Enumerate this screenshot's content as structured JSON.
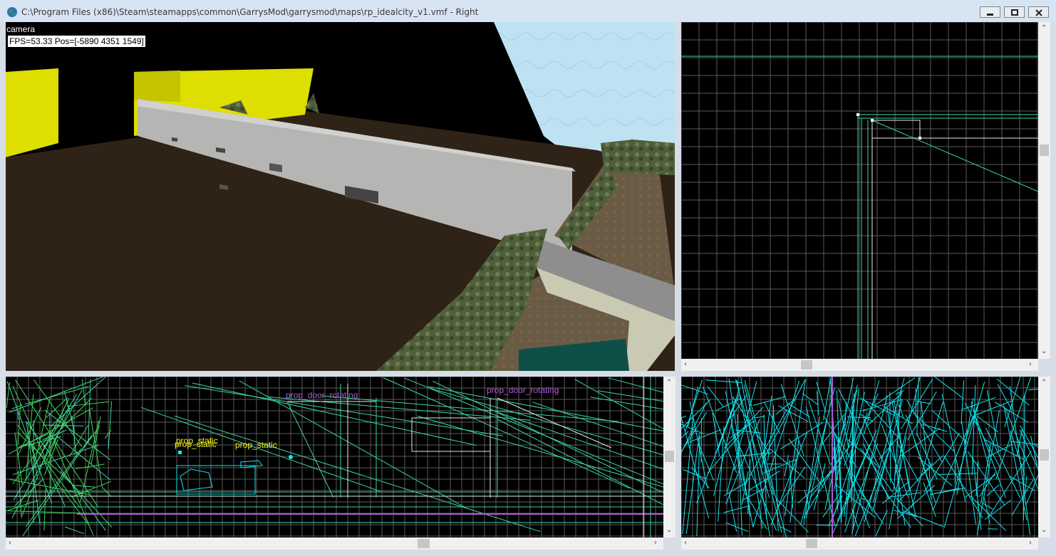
{
  "window": {
    "title": "C:\\Program Files (x86)\\Steam\\steamapps\\common\\GarrysMod\\garrysmod\\maps\\rp_idealcity_v1.vmf - Right",
    "minimize_icon": "minimize-icon",
    "restore_icon": "restore-icon",
    "close_icon": "close-icon"
  },
  "viewport_3d": {
    "view_label": "camera",
    "status": "FPS=53.33 Pos=[-5890 4351 1549]"
  },
  "viewport_front": {
    "entity_labels": [
      "prop_door_rotating",
      "prop_door_rotating",
      "prop_static",
      "prop_static",
      "prop_static"
    ]
  },
  "colors": {
    "grid": "#5a5a5a",
    "wire_green": "#3ed6a0",
    "wire_cyan": "#12e6f0",
    "wire_white": "#e6e6e6",
    "label_yellow": "#f5f516",
    "label_purple": "#b05ad6",
    "scrollbar": "#f0f0f0"
  }
}
